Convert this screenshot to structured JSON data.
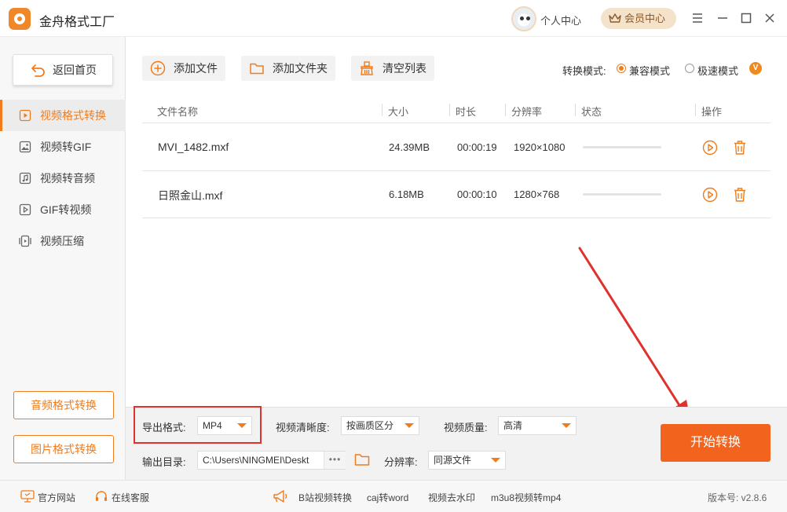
{
  "app": {
    "title": "金舟格式工厂",
    "personal_center": "个人中心",
    "vip_center": "会员中心"
  },
  "sidebar": {
    "back_label": "返回首页",
    "items": [
      {
        "label": "视频格式转换",
        "icon": "video-play-icon",
        "active": true
      },
      {
        "label": "视频转GIF",
        "icon": "image-icon",
        "active": false
      },
      {
        "label": "视频转音频",
        "icon": "music-note-icon",
        "active": false
      },
      {
        "label": "GIF转视频",
        "icon": "video-play-icon",
        "active": false
      },
      {
        "label": "视频压缩",
        "icon": "compress-icon",
        "active": false
      }
    ],
    "audio_btn": "音频格式转换",
    "image_btn": "图片格式转换"
  },
  "toolbar": {
    "add_file": "添加文件",
    "add_folder": "添加文件夹",
    "clear_list": "清空列表",
    "mode_label": "转换模式:",
    "mode_compat": "兼容模式",
    "mode_fast": "极速模式",
    "vip_badge": "V",
    "selected_mode": "兼容模式"
  },
  "table": {
    "columns": [
      "文件名称",
      "大小",
      "时长",
      "分辨率",
      "状态",
      "操作"
    ],
    "rows": [
      {
        "name": "MVI_1482.mxf",
        "size": "24.39MB",
        "duration": "00:00:19",
        "resolution": "1920×1080",
        "progress": 0
      },
      {
        "name": "日照金山.mxf",
        "size": "6.18MB",
        "duration": "00:00:10",
        "resolution": "1280×768",
        "progress": 0
      }
    ]
  },
  "settings": {
    "export_format_label": "导出格式:",
    "export_format_value": "MP4",
    "clarity_label": "视频清晰度:",
    "clarity_value": "按画质区分",
    "quality_label": "视频质量:",
    "quality_value": "高清",
    "output_dir_label": "输出目录:",
    "output_dir_value": "C:\\Users\\NINGMEI\\Deskt",
    "more_label": "•••",
    "resolution_label": "分辨率:",
    "resolution_value": "同源文件",
    "start_button": "开始转换"
  },
  "statusbar": {
    "official_site": "官方网站",
    "online_service": "在线客服",
    "links": [
      "B站视频转换",
      "caj转word",
      "视频去水印",
      "m3u8视频转mp4"
    ],
    "version": "版本号: v2.8.6"
  },
  "colors": {
    "accent": "#f07c1c",
    "start_button": "#f2631e",
    "annotation_red": "#e0322c"
  }
}
